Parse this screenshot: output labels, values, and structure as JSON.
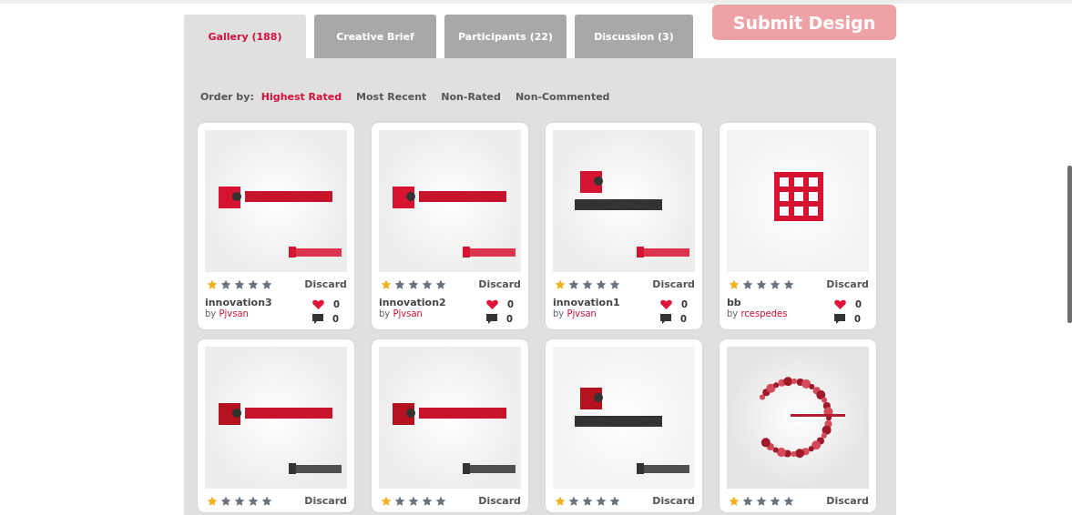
{
  "tabs": [
    {
      "label": "Gallery (188)",
      "selected": true
    },
    {
      "label": "Creative Brief",
      "selected": false
    },
    {
      "label": "Participants (22)",
      "selected": false
    },
    {
      "label": "Discussion (3)",
      "selected": false
    }
  ],
  "submit_button": "Submit Design",
  "order_by": {
    "label": "Order by:",
    "options": [
      {
        "label": "Highest Rated",
        "selected": true
      },
      {
        "label": "Most Recent",
        "selected": false
      },
      {
        "label": "Non-Rated",
        "selected": false
      },
      {
        "label": "Non-Commented",
        "selected": false
      }
    ]
  },
  "designs": [
    {
      "stars": 1,
      "action": "Discard",
      "title": "innovation3",
      "author_prefix": "by",
      "author": "Pjvsan",
      "likes": "0",
      "comments": "0"
    },
    {
      "stars": 1,
      "action": "Discard",
      "title": "innovation2",
      "author_prefix": "by",
      "author": "Pjvsan",
      "likes": "0",
      "comments": "0"
    },
    {
      "stars": 1,
      "action": "Discard",
      "title": "innovation1",
      "author_prefix": "by",
      "author": "Pjvsan",
      "likes": "0",
      "comments": "0"
    },
    {
      "stars": 1,
      "action": "Discard",
      "title": "bb",
      "author_prefix": "by",
      "author": "rcespedes",
      "likes": "0",
      "comments": "0"
    },
    {
      "stars": 1,
      "action": "Discard"
    },
    {
      "stars": 1,
      "action": "Discard"
    },
    {
      "stars": 1,
      "action": "Discard"
    },
    {
      "stars": 1,
      "action": "Discard"
    }
  ]
}
